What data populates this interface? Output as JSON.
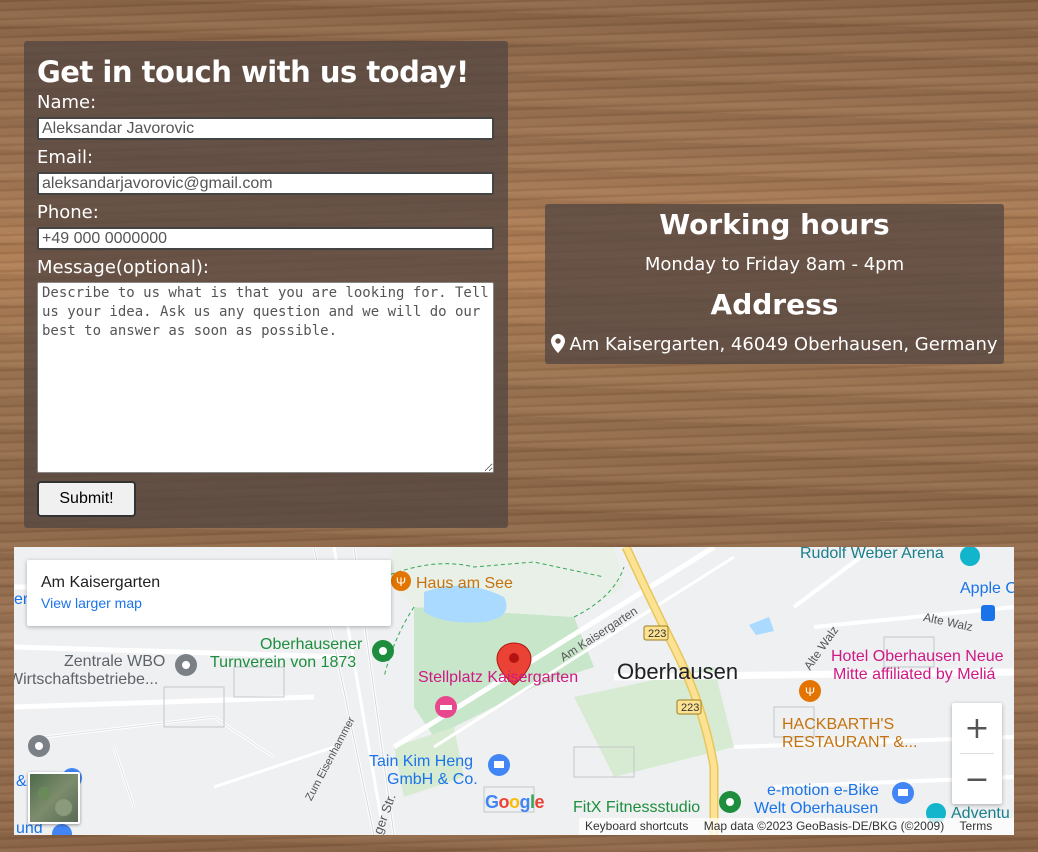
{
  "contact_form": {
    "title": "Get in touch with us today!",
    "name_label": "Name:",
    "name_placeholder": "Aleksandar Javorovic",
    "email_label": "Email:",
    "email_placeholder": "aleksandarjavorovic@gmail.com",
    "phone_label": "Phone:",
    "phone_placeholder": "+49 000 0000000",
    "message_label": "Message(optional):",
    "message_placeholder": "Describe to us what is that you are looking for. Tell us your idea. Ask us any question and we will do our best to answer as soon as possible.",
    "submit_label": "Submit!"
  },
  "info": {
    "hours_title": "Working hours",
    "hours_text": "Monday to Friday 8am - 4pm",
    "address_title": "Address",
    "address_text": "Am Kaisergarten, 46049 Oberhausen, Germany",
    "address_icon": "map-pin-icon"
  },
  "map": {
    "place_title": "Am Kaisergarten",
    "larger_map_link": "View larger map",
    "zoom_in": "+",
    "zoom_out": "−",
    "google_logo": "Google",
    "attribution": {
      "keyboard": "Keyboard shortcuts",
      "map_data": "Map data ©2023 GeoBasis-DE/BKG (©2009)",
      "terms": "Terms"
    },
    "labels": {
      "rudolf": "Rudolf Weber Arena",
      "haus_am_see": "Haus am See",
      "apple": "Apple C",
      "alte_walz_1": "Alte Walz",
      "alte_walz_2": "Alte Walz",
      "am_kaisergarten_road": "Am Kaisergarten",
      "route_223_a": "223",
      "route_223_b": "223",
      "oberhausener_1": "Oberhausener",
      "oberhausener_2": "Turnverein von 1873",
      "zentrale_1": "Zentrale WBO",
      "zentrale_2": "Wirtschaftsbetriebe...",
      "stellplatz": "Stellplatz Kaisergarten",
      "oberhausen": "Oberhausen",
      "hotel_1": "Hotel Oberhausen Neue",
      "hotel_2": "Mitte affiliated by Meliá",
      "hackbarth_1": "HACKBARTH'S",
      "hackbarth_2": "RESTAURANT &...",
      "zum_eisenhammer": "Zum Eisenhammer",
      "tain_1": "Tain Kim Heng",
      "tain_2": "GmbH & Co.",
      "fitx": "FitX Fitnessstudio",
      "emotion_1": "e-motion e-Bike",
      "emotion_2": "Welt Oberhausen",
      "adventu": "Adventu",
      "str": "ger Str.",
      "und": "und",
      "en": "en",
      "amp": "&"
    },
    "colors": {
      "park": "#c8e6c9",
      "water": "#aadaff",
      "highway": "#fde293",
      "road": "#ffffff",
      "marker": "#ea4335",
      "poi_green": "#1e8e3e",
      "poi_orange": "#e37400",
      "poi_pink": "#d01884",
      "poi_blue": "#1a73e8",
      "poi_gray": "#5f6368"
    }
  }
}
